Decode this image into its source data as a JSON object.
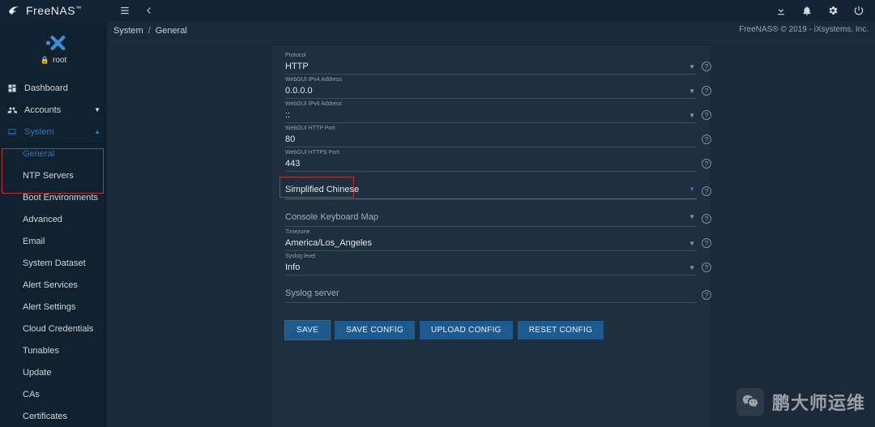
{
  "brand": {
    "name": "FreeNAS",
    "tm": "™"
  },
  "topbar": {
    "icons": {
      "menu": "menu-icon",
      "back": "chevron-left-icon",
      "download": "download-icon",
      "bell": "bell-icon",
      "gear": "gear-icon",
      "power": "power-icon"
    }
  },
  "sidebar": {
    "user": "root",
    "items": [
      {
        "label": "Dashboard",
        "icon": "dashboard-icon"
      },
      {
        "label": "Accounts",
        "icon": "users-icon",
        "caret": "down"
      },
      {
        "label": "System",
        "icon": "laptop-icon",
        "caret": "up",
        "active": true,
        "children": [
          {
            "label": "General",
            "active": true
          },
          {
            "label": "NTP Servers"
          },
          {
            "label": "Boot Environments"
          },
          {
            "label": "Advanced"
          },
          {
            "label": "Email"
          },
          {
            "label": "System Dataset"
          },
          {
            "label": "Alert Services"
          },
          {
            "label": "Alert Settings"
          },
          {
            "label": "Cloud Credentials"
          },
          {
            "label": "Tunables"
          },
          {
            "label": "Update"
          },
          {
            "label": "CAs"
          },
          {
            "label": "Certificates"
          }
        ]
      }
    ]
  },
  "breadcrumb": {
    "parent": "System",
    "current": "General"
  },
  "copyright": "FreeNAS® © 2019 - iXsystems, Inc.",
  "form": {
    "protocol": {
      "label": "Protocol",
      "value": "HTTP"
    },
    "ipv4": {
      "label": "WebGUI IPv4 Address",
      "value": "0.0.0.0"
    },
    "ipv6": {
      "label": "WebGUI IPv6 Address",
      "value": "::"
    },
    "http_port": {
      "label": "WebGUI HTTP Port",
      "value": "80"
    },
    "https_port": {
      "label": "WebGUI HTTPS Port",
      "value": "443"
    },
    "language": {
      "label": "",
      "value": "Simplified Chinese"
    },
    "kbdmap": {
      "label": "",
      "value": "Console Keyboard Map"
    },
    "timezone": {
      "label": "Timezone",
      "value": "America/Los_Angeles"
    },
    "syslog_level": {
      "label": "Syslog level",
      "value": "Info"
    },
    "syslog_server": {
      "label": "",
      "value": "Syslog server"
    }
  },
  "buttons": {
    "save": "SAVE",
    "save_config": "SAVE CONFIG",
    "upload_config": "UPLOAD CONFIG",
    "reset_config": "RESET CONFIG"
  },
  "watermark": "鹏大师运维"
}
